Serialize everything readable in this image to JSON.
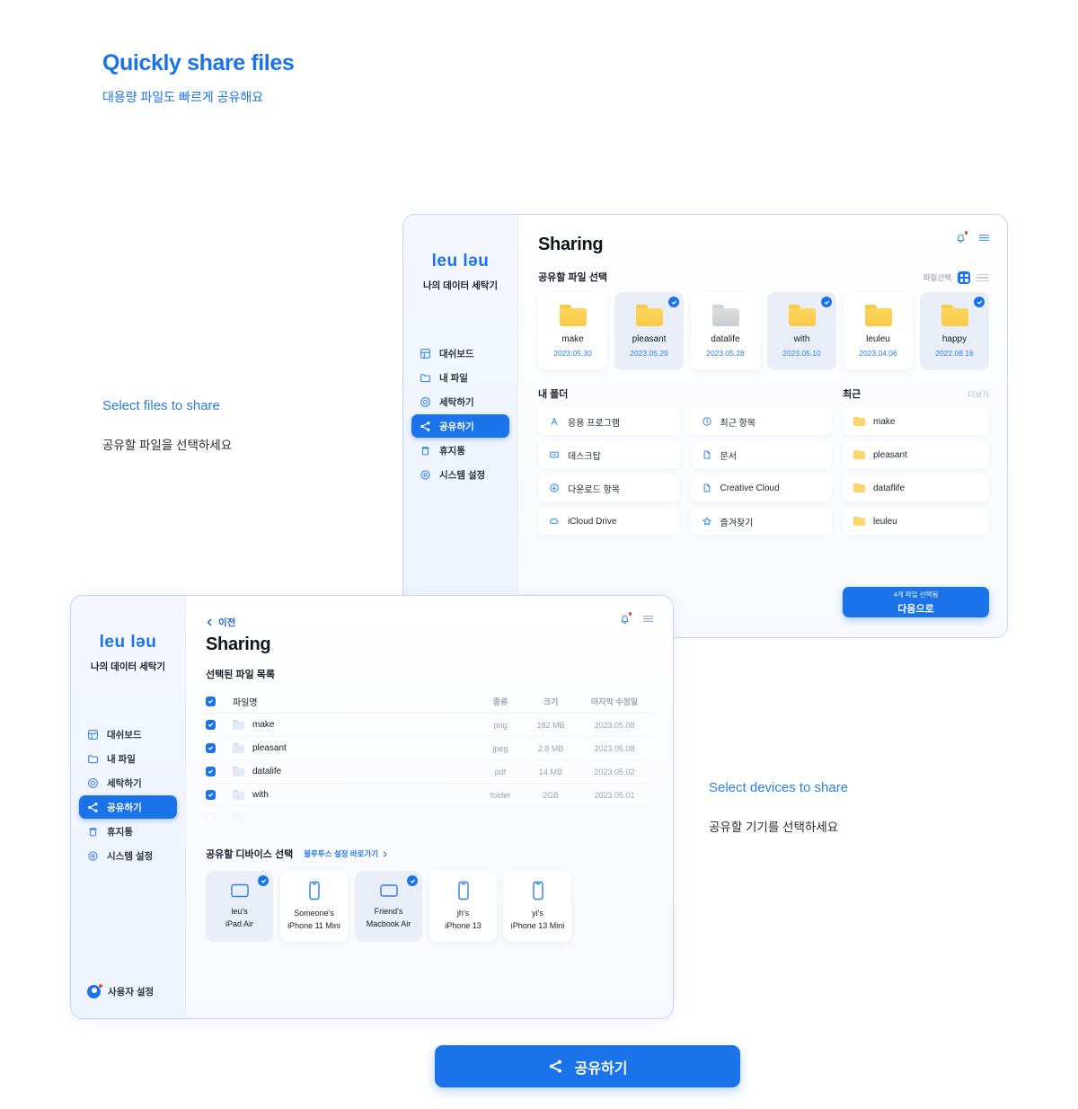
{
  "page": {
    "heading": "Quickly share files",
    "subheading": "대용량 파일도 빠르게 공유해요"
  },
  "annotations": {
    "files": {
      "title": "Select files to share",
      "desc": "공유할 파일을 선택하세요"
    },
    "devices": {
      "title": "Select devices to share",
      "desc": "공유할 기기를 선택하세요"
    }
  },
  "brand": {
    "logo": "leu ləu",
    "tagline": "나의 데이터 세탁기"
  },
  "sidebar": {
    "items": [
      {
        "label": "대쉬보드",
        "icon": "dashboard-icon",
        "active": false
      },
      {
        "label": "내 파일",
        "icon": "folder-icon",
        "active": false
      },
      {
        "label": "세탁하기",
        "icon": "washer-icon",
        "active": false
      },
      {
        "label": "공유하기",
        "icon": "share-icon",
        "active": true
      },
      {
        "label": "휴지통",
        "icon": "trash-icon",
        "active": false
      },
      {
        "label": "시스템 설정",
        "icon": "gear-icon",
        "active": false
      }
    ],
    "user_settings": "사용자 설정"
  },
  "upper_window": {
    "title": "Sharing",
    "section_files": "공유할 파일 선택",
    "view_label": "파일선택",
    "cards": [
      {
        "name": "make",
        "date": "2023.05.30",
        "selected": false,
        "gray": false
      },
      {
        "name": "pleasant",
        "date": "2023.05.29",
        "selected": true,
        "gray": false
      },
      {
        "name": "datalife",
        "date": "2023.05.28",
        "selected": false,
        "gray": true
      },
      {
        "name": "with",
        "date": "2023.05.10",
        "selected": true,
        "gray": false
      },
      {
        "name": "leuleu",
        "date": "2023.04.06",
        "selected": false,
        "gray": false
      },
      {
        "name": "happy",
        "date": "2022.08.16",
        "selected": true,
        "gray": false
      }
    ],
    "my_folder_label": "내 폴더",
    "my_folder_left": [
      {
        "label": "응용 프로그램",
        "icon": "applications-icon"
      },
      {
        "label": "데스크탑",
        "icon": "desktop-icon"
      },
      {
        "label": "다운로드 항목",
        "icon": "download-icon"
      },
      {
        "label": "iCloud Drive",
        "icon": "cloud-icon"
      }
    ],
    "my_folder_right": [
      {
        "label": "최근 항목",
        "icon": "clock-icon"
      },
      {
        "label": "문서",
        "icon": "document-icon"
      },
      {
        "label": "Creative Cloud",
        "icon": "document-icon"
      },
      {
        "label": "즐겨찾기",
        "icon": "star-icon"
      }
    ],
    "recent_label": "최근",
    "recent_more": "더보기",
    "recent_items": [
      {
        "label": "make"
      },
      {
        "label": "pleasant"
      },
      {
        "label": "dataflife"
      },
      {
        "label": "leuleu"
      }
    ],
    "next_button": {
      "count": "4개 파일 선택됨",
      "label": "다음으로"
    }
  },
  "lower_window": {
    "back": "이전",
    "title": "Sharing",
    "section_selected": "선택된 파일 목록",
    "table": {
      "headers": [
        "파일명",
        "종류",
        "크기",
        "마지막 수정일"
      ],
      "rows": [
        {
          "name": "make",
          "type": "png",
          "size": "182 MB",
          "modified": "2023.05.08",
          "checked": true
        },
        {
          "name": "pleasant",
          "type": "jpeg",
          "size": "2.8 MB",
          "modified": "2023.05.08",
          "checked": true
        },
        {
          "name": "datalife",
          "type": "pdf",
          "size": "14 MB",
          "modified": "2023.05.02",
          "checked": true
        },
        {
          "name": "with",
          "type": "folder",
          "size": "2GB",
          "modified": "2023.05.01",
          "checked": true
        }
      ]
    },
    "section_devices": "공유할 디바이스 선택",
    "bluetooth_link": "블루투스 설정 바로가기",
    "devices": [
      {
        "owner": "leu's",
        "model": "iPad Air",
        "kind": "tablet",
        "selected": true
      },
      {
        "owner": "Someone's",
        "model": "iPhone 11 Mini",
        "kind": "phone",
        "selected": false
      },
      {
        "owner": "Friend's",
        "model": "Macbook Air",
        "kind": "laptop",
        "selected": true
      },
      {
        "owner": "jh's",
        "model": "iPhone 13",
        "kind": "phone",
        "selected": false
      },
      {
        "owner": "yi's",
        "model": "iPhone 13 Mini",
        "kind": "phone",
        "selected": false
      }
    ],
    "share_button": "공유하기"
  },
  "colors": {
    "accent": "#1a73e8",
    "accent_light": "#2b7de9",
    "folder": "#f7c948",
    "alert": "#e8453c"
  }
}
